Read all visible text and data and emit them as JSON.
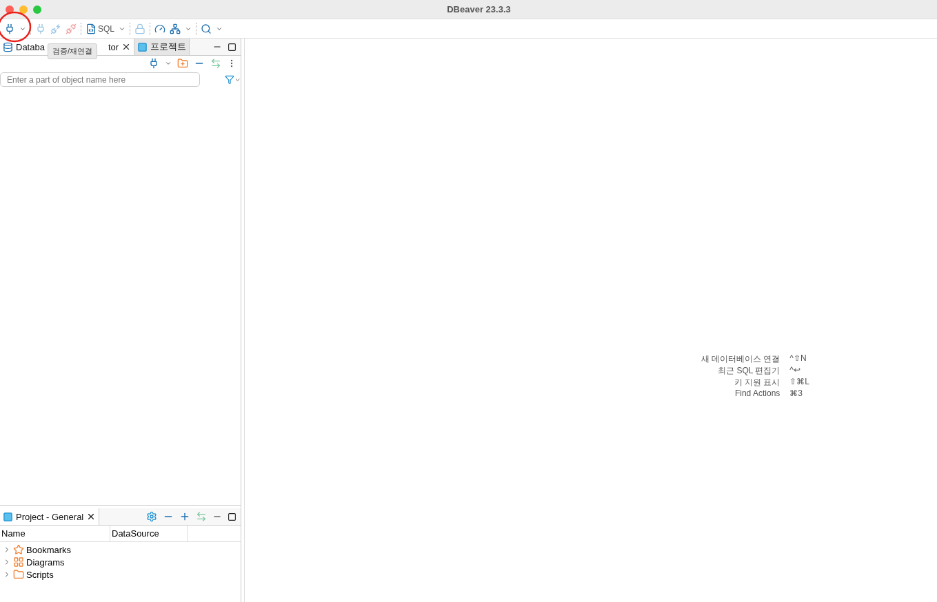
{
  "window": {
    "title": "DBeaver 23.3.3"
  },
  "toolbar": {
    "sql_label": "SQL"
  },
  "navigator": {
    "tabs": [
      {
        "label_start": "Databa",
        "label_end": "tor",
        "selected": true
      },
      {
        "label": "프로젝트",
        "selected": false
      }
    ],
    "tooltip": "검증/재연결",
    "search": {
      "placeholder": "Enter a part of object name here"
    }
  },
  "project": {
    "tab": {
      "label": "Project - General",
      "selected": true
    },
    "columns": [
      "Name",
      "DataSource"
    ],
    "items": [
      {
        "label": "Bookmarks",
        "kind": "bookmarks",
        "expanded": false
      },
      {
        "label": "Diagrams",
        "kind": "diagrams",
        "expanded": false
      },
      {
        "label": "Scripts",
        "kind": "scripts",
        "expanded": false
      }
    ]
  },
  "hints": [
    {
      "label": "새 데이터베이스 연결",
      "shortcut": "^⇧N"
    },
    {
      "label": "최근 SQL 편집기",
      "shortcut": "^↩"
    },
    {
      "label": "키 지원 표시",
      "shortcut": "⇧⌘L"
    },
    {
      "label": "Find Actions",
      "shortcut": "⌘3"
    }
  ]
}
